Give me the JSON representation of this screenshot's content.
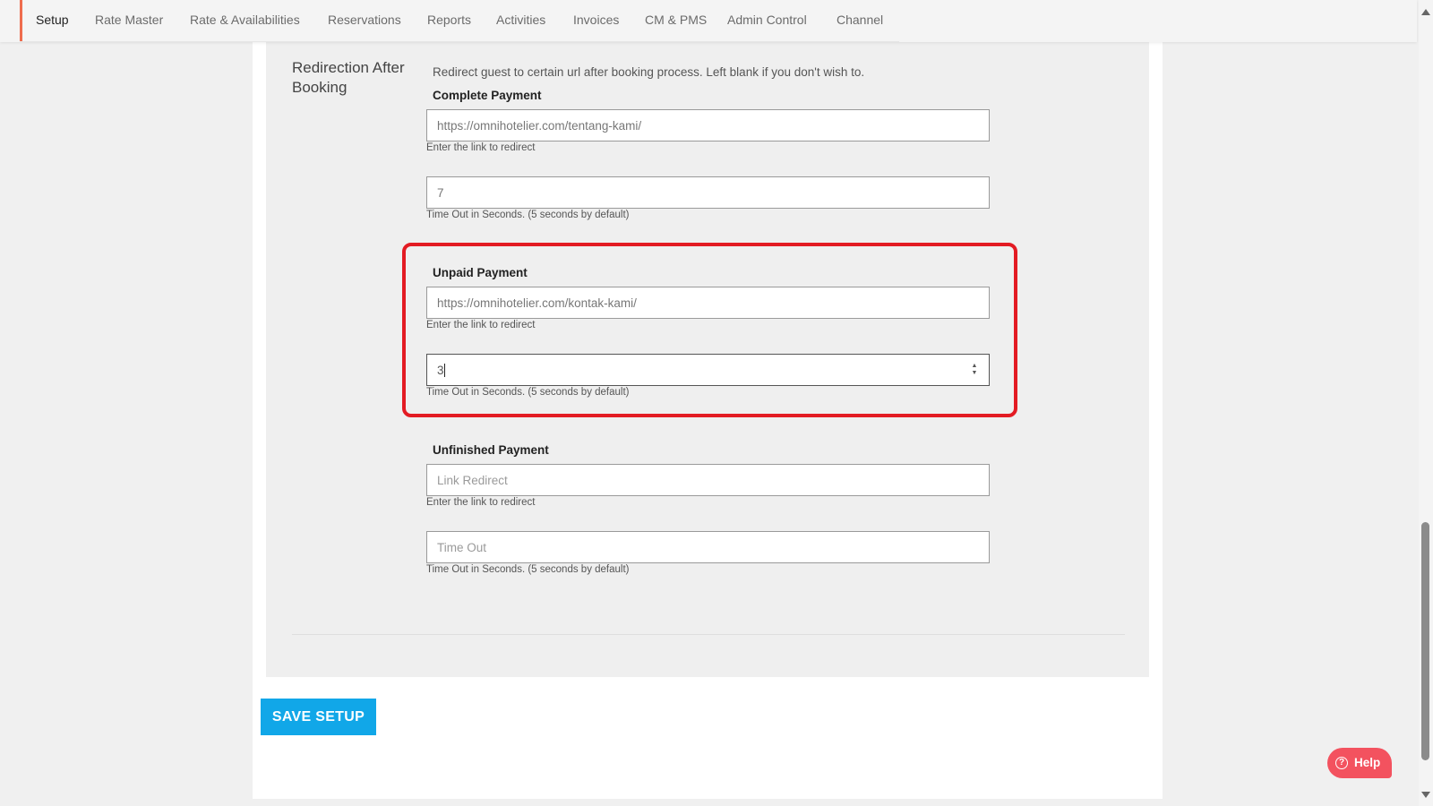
{
  "nav": {
    "items": [
      {
        "label": "Setup"
      },
      {
        "label": "Rate Master"
      },
      {
        "label": "Rate & Availabilities"
      },
      {
        "label": "Reservations"
      },
      {
        "label": "Reports"
      },
      {
        "label": "Activities"
      },
      {
        "label": "Invoices"
      },
      {
        "label": "CM & PMS"
      },
      {
        "label": "Admin Control"
      },
      {
        "label": "Channel"
      }
    ],
    "active": "Setup",
    "accent_color": "#ee6c4d"
  },
  "redirection": {
    "title": "Redirection After Booking",
    "description": "Redirect guest to certain url after booking process. Left blank if you don't wish to.",
    "complete": {
      "label": "Complete Payment",
      "link_value": "https://omnihotelier.com/tentang-kami/",
      "link_hint": "Enter the link to redirect",
      "timeout_value": "7",
      "timeout_hint": "Time Out in Seconds. (5 seconds by default)"
    },
    "unpaid": {
      "label": "Unpaid Payment",
      "link_value": "https://omnihotelier.com/kontak-kami/",
      "link_hint": "Enter the link to redirect",
      "timeout_value": "3",
      "timeout_hint": "Time Out in Seconds. (5 seconds by default)"
    },
    "unfinished": {
      "label": "Unfinished Payment",
      "link_placeholder": "Link Redirect",
      "link_hint": "Enter the link to redirect",
      "timeout_placeholder": "Time Out",
      "timeout_hint": "Time Out in Seconds. (5 seconds by default)"
    }
  },
  "actions": {
    "save_label": "SAVE SETUP",
    "save_color": "#11a7e8",
    "help_label": "Help",
    "help_icon": "question-circle-icon",
    "help_color": "#f3525f"
  },
  "annotation": {
    "highlight_color": "#e31b23"
  },
  "icons": {
    "spin_up": "▲",
    "spin_down": "▼",
    "help": "?"
  }
}
